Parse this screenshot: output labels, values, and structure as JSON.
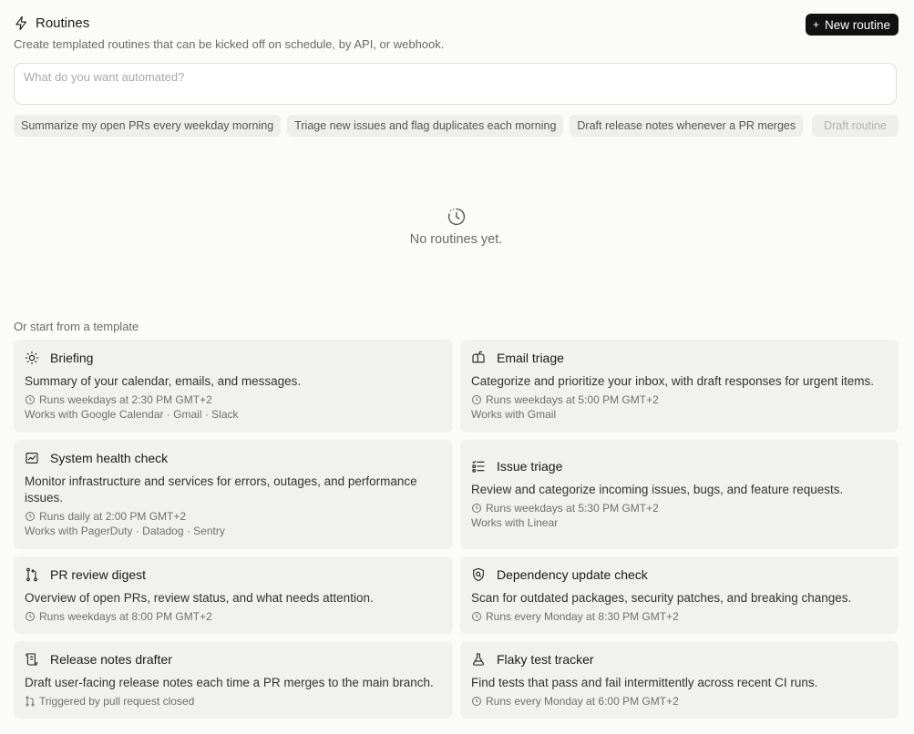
{
  "header": {
    "title": "Routines",
    "subtitle": "Create templated routines that can be kicked off on schedule, by API, or webhook.",
    "new_button": "New routine"
  },
  "prompt": {
    "placeholder": "What do you want automated?"
  },
  "suggestions": [
    "Summarize my open PRs every weekday morning",
    "Triage new issues and flag duplicates each morning",
    "Draft release notes whenever a PR merges"
  ],
  "draft_button": "Draft routine",
  "empty_state": "No routines yet.",
  "templates_label": "Or start from a template",
  "templates": [
    {
      "name": "Briefing",
      "icon": "sun-icon",
      "desc": "Summary of your calendar, emails, and messages.",
      "schedule": "Runs weekdays at 2:30 PM GMT+2",
      "works": "Works with Google Calendar · Gmail · Slack"
    },
    {
      "name": "Email triage",
      "icon": "mailbox-icon",
      "desc": "Categorize and prioritize your inbox, with draft responses for urgent items.",
      "schedule": "Runs weekdays at 5:00 PM GMT+2",
      "works": "Works with Gmail"
    },
    {
      "name": "System health check",
      "icon": "chart-icon",
      "desc": "Monitor infrastructure and services for errors, outages, and performance issues.",
      "schedule": "Runs daily at 2:00 PM GMT+2",
      "works": "Works with PagerDuty · Datadog · Sentry"
    },
    {
      "name": "Issue triage",
      "icon": "checklist-icon",
      "desc": "Review and categorize incoming issues, bugs, and feature requests.",
      "schedule": "Runs weekdays at 5:30 PM GMT+2",
      "works": "Works with Linear"
    },
    {
      "name": "PR review digest",
      "icon": "pull-request-icon",
      "desc": "Overview of open PRs, review status, and what needs attention.",
      "schedule": "Runs weekdays at 8:00 PM GMT+2",
      "works": ""
    },
    {
      "name": "Dependency update check",
      "icon": "shield-search-icon",
      "desc": "Scan for outdated packages, security patches, and breaking changes.",
      "schedule": "Runs every Monday at 8:30 PM GMT+2",
      "works": ""
    },
    {
      "name": "Release notes drafter",
      "icon": "scroll-icon",
      "desc": "Draft user-facing release notes each time a PR merges to the main branch.",
      "schedule": "Triggered by pull request closed",
      "works": ""
    },
    {
      "name": "Flaky test tracker",
      "icon": "flask-icon",
      "desc": "Find tests that pass and fail intermittently across recent CI runs.",
      "schedule": "Runs every Monday at 6:00 PM GMT+2",
      "works": ""
    }
  ]
}
